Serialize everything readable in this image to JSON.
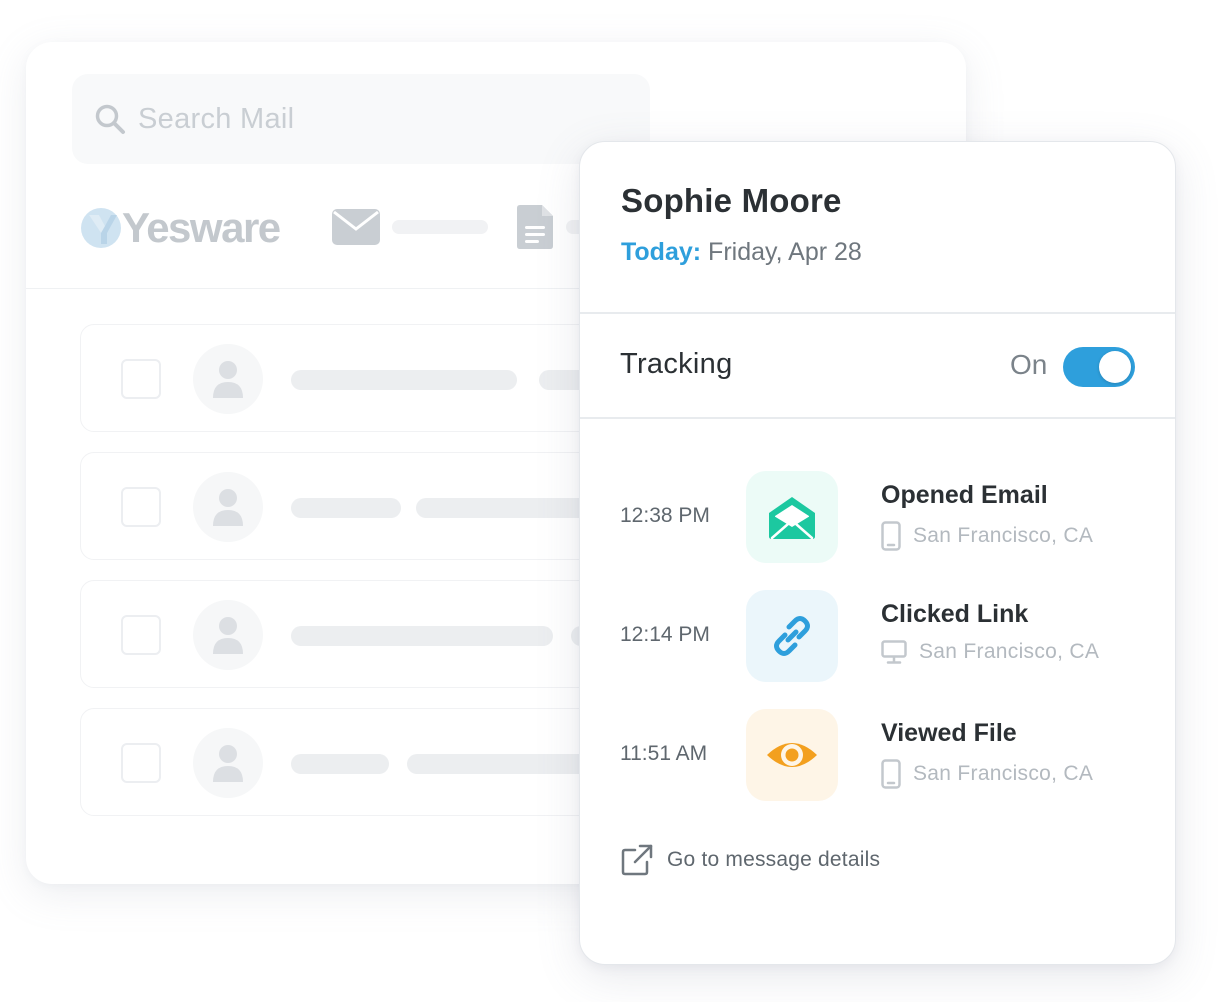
{
  "mail_app": {
    "search_placeholder": "Search Mail",
    "brand_name": "Yesware",
    "rows": [
      {
        "id": 1
      },
      {
        "id": 2
      },
      {
        "id": 3
      },
      {
        "id": 4
      }
    ]
  },
  "tracking_card": {
    "contact_name": "Sophie Moore",
    "date_prefix": "Today:",
    "date_value": "Friday, Apr 28",
    "tracking_label": "Tracking",
    "tracking_state_label": "On",
    "tracking_enabled": true,
    "events": [
      {
        "time": "12:38 PM",
        "title": "Opened Email",
        "location": "San Francisco, CA",
        "device": "mobile-icon",
        "icon": "open-envelope-icon",
        "color": "#1cc8a0",
        "bg": "#ecfbf7"
      },
      {
        "time": "12:14 PM",
        "title": "Clicked Link",
        "location": "San Francisco, CA",
        "device": "desktop-icon",
        "icon": "link-icon",
        "color": "#2e9fdc",
        "bg": "#ebf6fb"
      },
      {
        "time": "11:51 AM",
        "title": "Viewed File",
        "location": "San Francisco, CA",
        "device": "mobile-icon",
        "icon": "eye-icon",
        "color": "#f3a01f",
        "bg": "#fef5e7"
      }
    ],
    "details_link": "Go to message details"
  },
  "colors": {
    "accent_blue": "#2e9fdc",
    "text_dark": "#2b3034",
    "text_muted": "#6f777e",
    "text_faint": "#b3b9bf"
  }
}
